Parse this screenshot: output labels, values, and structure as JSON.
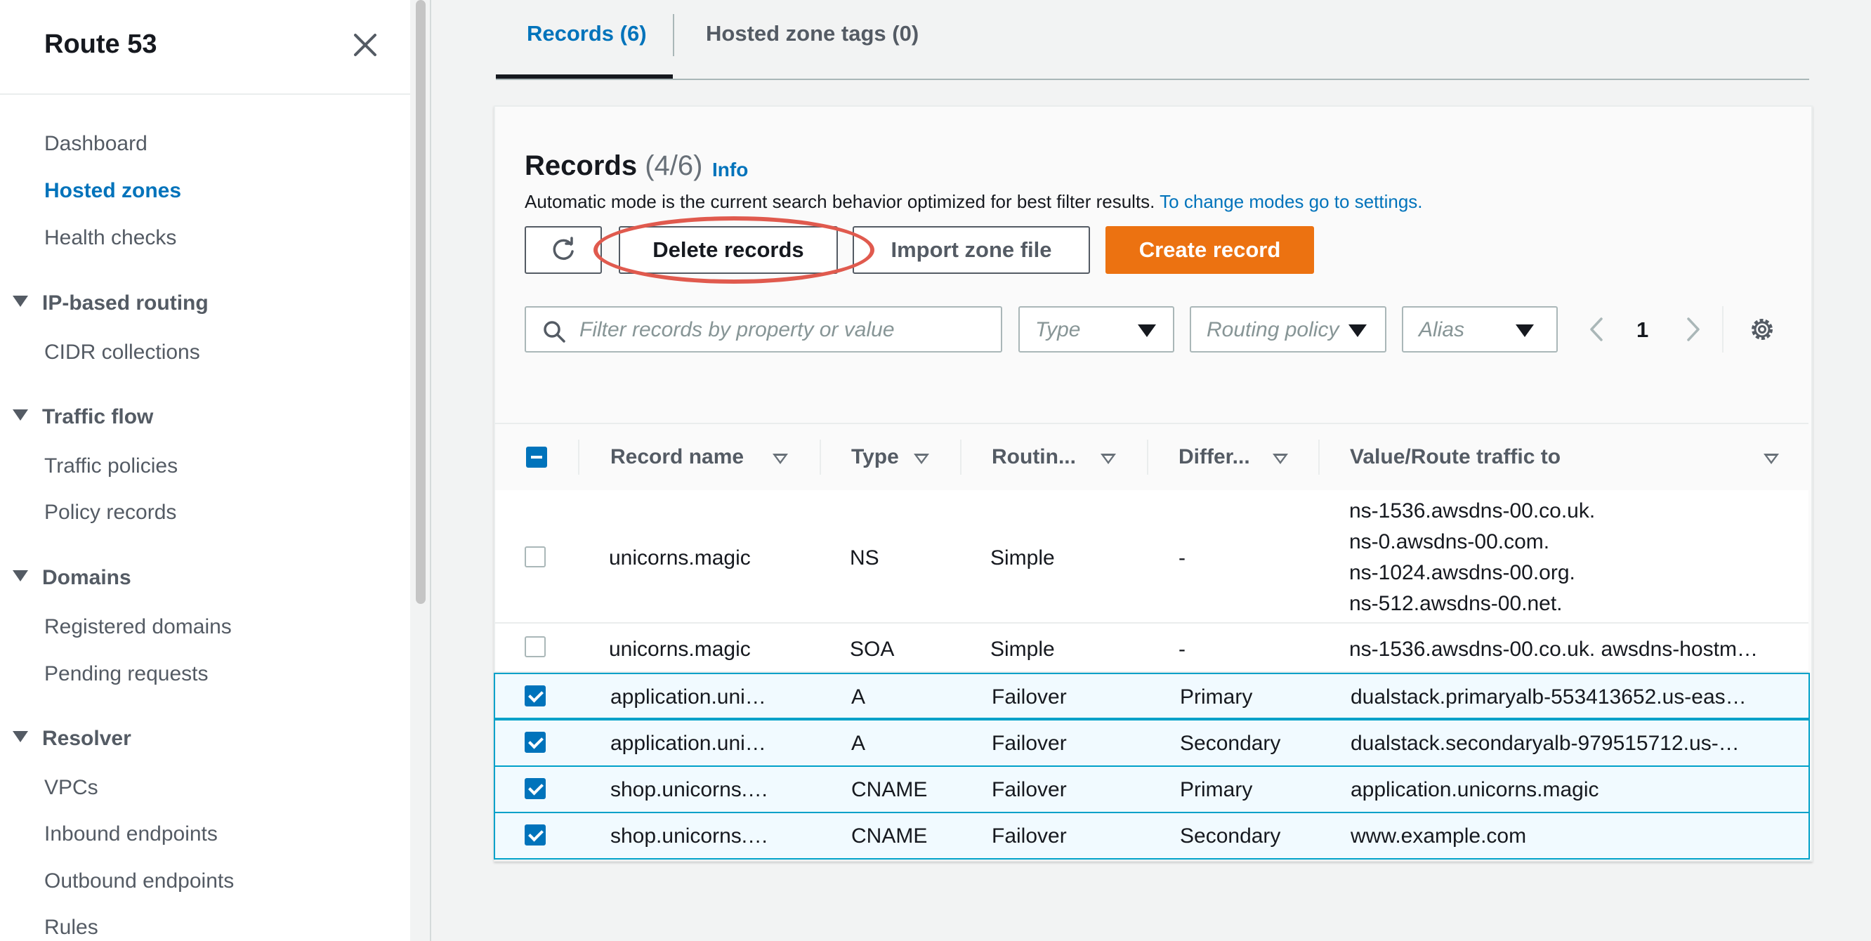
{
  "sidebar": {
    "title": "Route 53",
    "items": {
      "dashboard": "Dashboard",
      "hosted_zones": "Hosted zones",
      "health_checks": "Health checks",
      "cidr_collections": "CIDR collections",
      "traffic_policies": "Traffic policies",
      "policy_records": "Policy records",
      "registered_domains": "Registered domains",
      "pending_requests": "Pending requests",
      "vpcs": "VPCs",
      "inbound_endpoints": "Inbound endpoints",
      "outbound_endpoints": "Outbound endpoints",
      "rules": "Rules"
    },
    "sections": {
      "ip_routing": "IP-based routing",
      "traffic_flow": "Traffic flow",
      "domains": "Domains",
      "resolver": "Resolver"
    }
  },
  "tabs": {
    "records": "Records (6)",
    "tags": "Hosted zone tags (0)"
  },
  "records_panel": {
    "title": "Records",
    "count": "(4/6)",
    "info": "Info",
    "description": "Automatic mode is the current search behavior optimized for best filter results.",
    "settings_link": "To change modes go to settings."
  },
  "toolbar": {
    "delete": "Delete records",
    "import": "Import zone file",
    "create": "Create record"
  },
  "filters": {
    "search_placeholder": "Filter records by property or value",
    "type": "Type",
    "routing_policy": "Routing policy",
    "alias": "Alias",
    "page": "1"
  },
  "table": {
    "headers": {
      "record_name": "Record name",
      "type": "Type",
      "routing": "Routin...",
      "differ": "Differ...",
      "value": "Value/Route traffic to"
    },
    "rows": [
      {
        "name": "unicorns.magic",
        "type": "NS",
        "routing": "Simple",
        "differ": "-",
        "value": "ns-1536.awsdns-00.co.uk.\nns-0.awsdns-00.com.\nns-1024.awsdns-00.org.\nns-512.awsdns-00.net.",
        "selected": false
      },
      {
        "name": "unicorns.magic",
        "type": "SOA",
        "routing": "Simple",
        "differ": "-",
        "value": "ns-1536.awsdns-00.co.uk. awsdns-hostm…",
        "selected": false
      },
      {
        "name": "application.uni…",
        "type": "A",
        "routing": "Failover",
        "differ": "Primary",
        "value": "dualstack.primaryalb-553413652.us-eas…",
        "selected": true
      },
      {
        "name": "application.uni…",
        "type": "A",
        "routing": "Failover",
        "differ": "Secondary",
        "value": "dualstack.secondaryalb-979515712.us-…",
        "selected": true
      },
      {
        "name": "shop.unicorns.…",
        "type": "CNAME",
        "routing": "Failover",
        "differ": "Primary",
        "value": "application.unicorns.magic",
        "selected": true
      },
      {
        "name": "shop.unicorns.…",
        "type": "CNAME",
        "routing": "Failover",
        "differ": "Secondary",
        "value": "www.example.com",
        "selected": true
      }
    ]
  },
  "colors": {
    "accent_blue": "#0073bb",
    "create_orange": "#ec7211",
    "annotation_red": "#e05a4e",
    "selected_row_border": "#00a1c9"
  }
}
